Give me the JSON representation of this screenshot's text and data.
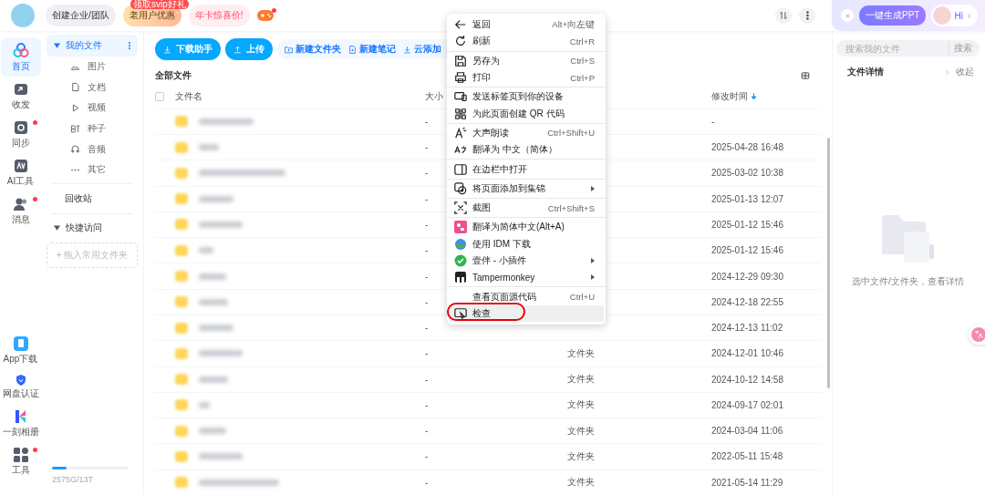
{
  "topbar": {
    "chips": [
      {
        "label": "创建企业/团队",
        "kind": "plain"
      },
      {
        "label": "老用户优惠",
        "kind": "gold",
        "badge": "领取svip好礼"
      },
      {
        "label": "年卡惊喜价!",
        "kind": "pink"
      }
    ],
    "game_dot": true,
    "ai_button": "一键生成PPT",
    "greeting": "Hi"
  },
  "rail": {
    "top": [
      {
        "label": "首页",
        "selected": true,
        "dot": false
      },
      {
        "label": "收发",
        "selected": false,
        "dot": false
      },
      {
        "label": "同步",
        "selected": false,
        "dot": true
      },
      {
        "label": "AI工具",
        "selected": false,
        "dot": false
      },
      {
        "label": "消息",
        "selected": false,
        "dot": true
      }
    ],
    "bottom": [
      {
        "label": "App下载",
        "dot": false
      },
      {
        "label": "网盘认证",
        "dot": false
      },
      {
        "label": "一刻相册",
        "dot": false
      },
      {
        "label": "工具",
        "dot": true
      }
    ]
  },
  "nav": {
    "my_files": {
      "label": "我的文件",
      "selected": true,
      "expanded": true
    },
    "categories": [
      "图片",
      "文档",
      "视频",
      "种子",
      "音频",
      "其它"
    ],
    "trash": "回收站",
    "quick": {
      "label": "快捷访问",
      "expanded": true
    },
    "dropzone": "+ 拖入常用文件夹",
    "storage": {
      "level": 0.19,
      "text": "2575G/13T"
    }
  },
  "toolbar": {
    "primary": [
      "下载助手",
      "上传"
    ],
    "secondary": [
      "新建文件夹",
      "新建笔记",
      "云添加"
    ]
  },
  "breadcrumb": "全部文件",
  "table": {
    "select_all_checked": false,
    "columns": [
      "文件名",
      "大小",
      "修改时间"
    ],
    "rows": [
      {
        "size": "-",
        "modified": "-"
      },
      {
        "size": "-",
        "modified": "2025-04-28 16:48"
      },
      {
        "size": "-",
        "modified": "2025-03-02 10:38"
      },
      {
        "size": "-",
        "modified": "2025-01-13 12:07"
      },
      {
        "size": "-",
        "modified": "2025-01-12 15:46"
      },
      {
        "size": "-",
        "modified": "2025-01-12 15:46"
      },
      {
        "size": "-",
        "modified": "2024-12-29 09:30"
      },
      {
        "size": "-",
        "modified": "2024-12-18 22:55"
      },
      {
        "size": "-",
        "modified": "2024-12-13 11:02"
      },
      {
        "size": "-",
        "type": "文件夹",
        "modified": "2024-12-01 10:46"
      },
      {
        "size": "-",
        "type": "文件夹",
        "modified": "2024-10-12 14:58"
      },
      {
        "size": "-",
        "type": "文件夹",
        "modified": "2024-09-17 02:01"
      },
      {
        "size": "-",
        "type": "文件夹",
        "modified": "2024-03-04 11:06"
      },
      {
        "size": "-",
        "type": "文件夹",
        "modified": "2022-05-11 15:48"
      },
      {
        "size": "-",
        "type": "文件夹",
        "modified": "2021-05-14 11:29"
      }
    ]
  },
  "details": {
    "search_placeholder": "搜索我的文件",
    "search_button": "搜索",
    "title": "文件详情",
    "collapse": "收起",
    "empty": "选中文件/文件夹，查看详情"
  },
  "context_menu": {
    "groups": [
      [
        {
          "label": "返回",
          "shortcut": "Alt+向左键",
          "submenu": false,
          "hovered": false,
          "circled": false
        },
        {
          "label": "刷新",
          "shortcut": "Ctrl+R",
          "submenu": false,
          "hovered": false,
          "circled": false
        }
      ],
      [
        {
          "label": "另存为",
          "shortcut": "Ctrl+S",
          "submenu": false,
          "hovered": false,
          "circled": false
        },
        {
          "label": "打印",
          "shortcut": "Ctrl+P",
          "submenu": false,
          "hovered": false,
          "circled": false
        }
      ],
      [
        {
          "label": "发送标签页到你的设备",
          "submenu": false,
          "hovered": false,
          "circled": false
        },
        {
          "label": "为此页面创建 QR 代码",
          "submenu": false,
          "hovered": false,
          "circled": false
        }
      ],
      [
        {
          "label": "大声朗读",
          "shortcut": "Ctrl+Shift+U",
          "submenu": false,
          "hovered": false,
          "circled": false
        },
        {
          "label": "翻译为 中文（简体）",
          "submenu": false,
          "hovered": false,
          "circled": false
        }
      ],
      [
        {
          "label": "在边栏中打开",
          "submenu": false,
          "hovered": false,
          "circled": false
        }
      ],
      [
        {
          "label": "将页面添加到集锦",
          "submenu": true,
          "hovered": false,
          "circled": false
        }
      ],
      [
        {
          "label": "截图",
          "shortcut": "Ctrl+Shift+S",
          "submenu": false,
          "hovered": false,
          "circled": false
        }
      ],
      [
        {
          "label": "翻译为简体中文(Alt+A)",
          "submenu": false,
          "hovered": false,
          "circled": false
        },
        {
          "label": "使用 IDM 下载",
          "submenu": false,
          "hovered": false,
          "circled": false
        },
        {
          "label": "壹伴 - 小插件",
          "submenu": true,
          "hovered": false,
          "circled": false
        },
        {
          "label": "Tampermonkey",
          "submenu": true,
          "hovered": false,
          "circled": false
        }
      ],
      [
        {
          "label": "查看页面源代码",
          "shortcut": "Ctrl+U",
          "submenu": false,
          "hovered": false,
          "circled": false
        },
        {
          "label": "检查",
          "submenu": false,
          "hovered": true,
          "circled": true
        }
      ]
    ]
  }
}
